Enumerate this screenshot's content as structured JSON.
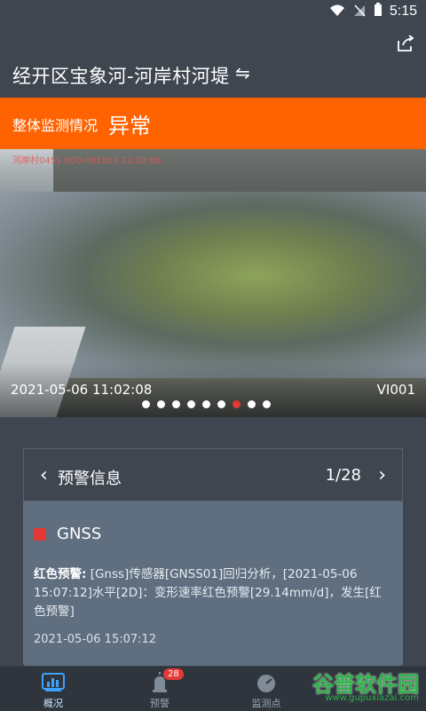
{
  "status_bar": {
    "time": "5:15"
  },
  "header": {
    "title": "经开区宝象河-河岸村河堤",
    "swap_symbol": "⇋"
  },
  "status": {
    "label": "整体监测情况",
    "value": "异常",
    "color": "#ff6200"
  },
  "photo": {
    "timestamp": "2021-05-06 11:02:08",
    "device_id": "VI001",
    "overlay_text": "河岸村0451 000-001003 11:02:08",
    "dots_total": 9,
    "dots_active_index": 6
  },
  "warning_card": {
    "title": "预警信息",
    "pager": "1/28",
    "sensor": "GNSS",
    "warning_label": "红色预警:",
    "warning_body": "[Gnss]传感器[GNSS01]回归分析，[2021-05-06 15:07:12]水平[2D]：变形速率红色预警[29.14mm/d]，发生[红色预警]",
    "time": "2021-05-06 15:07:12"
  },
  "nav": [
    {
      "label": "概况",
      "icon": "chart-icon",
      "active": true
    },
    {
      "label": "预警",
      "icon": "alarm-icon",
      "badge": "28"
    },
    {
      "label": "监测点",
      "icon": "gauge-icon"
    }
  ],
  "watermark": {
    "text": "谷普软件园",
    "url": "www.gupuxiazai.com"
  }
}
